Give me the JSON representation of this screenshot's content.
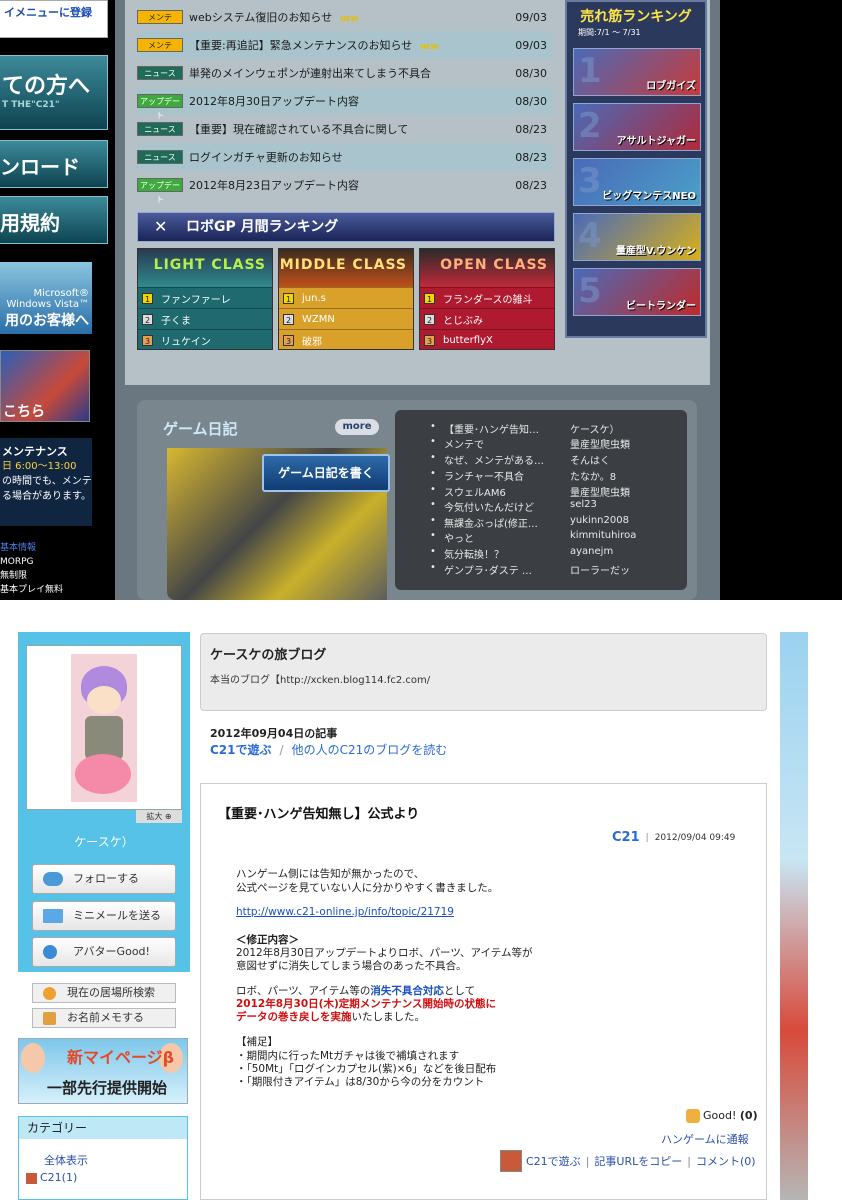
{
  "top": {
    "left_menu": {
      "register_tail": "イメニューに登録",
      "newcomers": "ての方へ",
      "newcomers_sub": "T THE\"C21\"",
      "download": "ンロード",
      "terms": "用規約",
      "vista_line1": "Microsoft®",
      "vista_line2": "Windows Vista™",
      "vista_line3": "用のお客様へ",
      "campaign": "こちら",
      "maint_title": "メンテナンス",
      "maint_time": "日 6:00～13:00",
      "maint_note1": "の時間でも、メンテ",
      "maint_note2": "る場合があります。",
      "info_title": "基本情報",
      "info_genre": "MORPG",
      "info_limit": "無制限",
      "info_price": "基本プレイ無料"
    },
    "news": [
      {
        "tag": "メンテ",
        "tag_type": "m",
        "title": "webシステム復旧のお知らせ",
        "new": "NEW",
        "date": "09/03"
      },
      {
        "tag": "メンテ",
        "tag_type": "m",
        "title": "【重要:再追記】緊急メンテナンスのお知らせ",
        "new": "NEW",
        "date": "09/03"
      },
      {
        "tag": "ニュース",
        "tag_type": "n",
        "title": "単発のメインウェポンが連射出来てしまう不具合",
        "new": "",
        "date": "08/30"
      },
      {
        "tag": "アップデート",
        "tag_type": "u",
        "title": "2012年8月30日アップデート内容",
        "new": "",
        "date": "08/30"
      },
      {
        "tag": "ニュース",
        "tag_type": "n",
        "title": "【重要】現在確認されている不具合に関して",
        "new": "",
        "date": "08/23"
      },
      {
        "tag": "ニュース",
        "tag_type": "n",
        "title": "ログインガチャ更新のお知らせ",
        "new": "",
        "date": "08/23"
      },
      {
        "tag": "アップデート",
        "tag_type": "u",
        "title": "2012年8月23日アップデート内容",
        "new": "",
        "date": "08/23"
      }
    ],
    "robogp": {
      "title": "ロボGP 月間ランキング",
      "classes": [
        {
          "name": "LIGHT CLASS",
          "ranks": [
            "ファンファーレ",
            "子くま",
            "リュケイン"
          ]
        },
        {
          "name": "MIDDLE CLASS",
          "ranks": [
            "jun.s",
            "WZMN",
            "破邪"
          ]
        },
        {
          "name": "OPEN CLASS",
          "ranks": [
            "フランダースの雑斗",
            "とじぶみ",
            "butterflyX"
          ]
        }
      ]
    },
    "best_seller": {
      "title": "売れ筋ランキング",
      "period": "期間:7/1 ～ 7/31",
      "items": [
        "ロブガイズ",
        "アサルトジャガー",
        "ビッグマンテスNEO",
        "量産型V.ウンケン",
        "ビートランダー"
      ]
    },
    "diary": {
      "title": "ゲーム日記",
      "more": "more",
      "write": "ゲーム日記を書く",
      "entries": [
        {
          "title": "【重要･ハンゲ告知…",
          "user": "ケースケ）"
        },
        {
          "title": "メンテで",
          "user": "量産型爬虫類"
        },
        {
          "title": "なぜ、メンテがある…",
          "user": "そんはく"
        },
        {
          "title": "ランチャー不具合",
          "user": "たなか。8"
        },
        {
          "title": "スウェルAM6",
          "user": "量産型爬虫類"
        },
        {
          "title": "今気付いたんだけど",
          "user": "sel23"
        },
        {
          "title": "無課金ぶっぱ(修正…",
          "user": "yukinn2008"
        },
        {
          "title": "やっと",
          "user": "kimmituhiroa"
        },
        {
          "title": "気分転換！？",
          "user": "ayanejm"
        },
        {
          "title": "ゲンプラ･ダステ …",
          "user": "ローラーだッ"
        }
      ]
    }
  },
  "blog": {
    "user_name": "ケースケ）",
    "zoom_label": "拡大",
    "sidebar_buttons": [
      "フォローする",
      "ミニメールを送る",
      "アバターGood!"
    ],
    "sidebar_links": [
      "現在の居場所検索",
      "お名前メモする"
    ],
    "banner_line1": "新マイページβ",
    "banner_line2": "一部先行提供開始",
    "category_title": "カテゴリー",
    "category_all": "全体表示",
    "category_c21": "C21(1)",
    "blog_title": "ケースケの旅ブログ",
    "blog_url": "本当のブログ【http://xcken.blog114.fc2.com/",
    "article_date": "2012年09月04日の記事",
    "nav_c21": "C21で遊ぶ",
    "nav_sep": "/",
    "nav_others": "他の人のC21のブログを読む",
    "article_title": "【重要･ハンゲ告知無し】公式より",
    "article_game": "C21",
    "article_bar": "|",
    "article_time": "2012/09/04 09:49",
    "body": {
      "l1": "ハンゲーム側には告知が無かったので、",
      "l2": "公式ページを見ていない人に分かりやすく書きました。",
      "link": "http://www.c21-online.jp/info/topic/21719",
      "h1": "＜修正内容＞",
      "l3": "2012年8月30日アップデートよりロボ、パーツ、アイテム等が",
      "l4": "意図せずに消失してしまう場合のあった不具合。",
      "l5a": "ロボ、パーツ、アイテム等の",
      "l5b": "消失不具合対応",
      "l5c": "として",
      "l6": "2012年8月30日(木)定期メンテナンス開始時の状態に",
      "l7a": "データの巻き戻しを実施",
      "l7b": "いたしました。",
      "h2": "【補足】",
      "l8": "・期間内に行ったMtガチャは後で補填されます",
      "l9": "・「50Mt」「ログインカプセル(紫)×6」などを後日配布",
      "l10": "・「期限付きアイテム」は8/30から今の分をカウント"
    },
    "good_label": "Good!",
    "good_count": "(0)",
    "report": "ハンゲームに通報",
    "foot_c21": "C21で遊ぶ",
    "foot_copy": "記事URLをコピー",
    "foot_comment": "コメント(0)",
    "foot_bar": "|"
  }
}
